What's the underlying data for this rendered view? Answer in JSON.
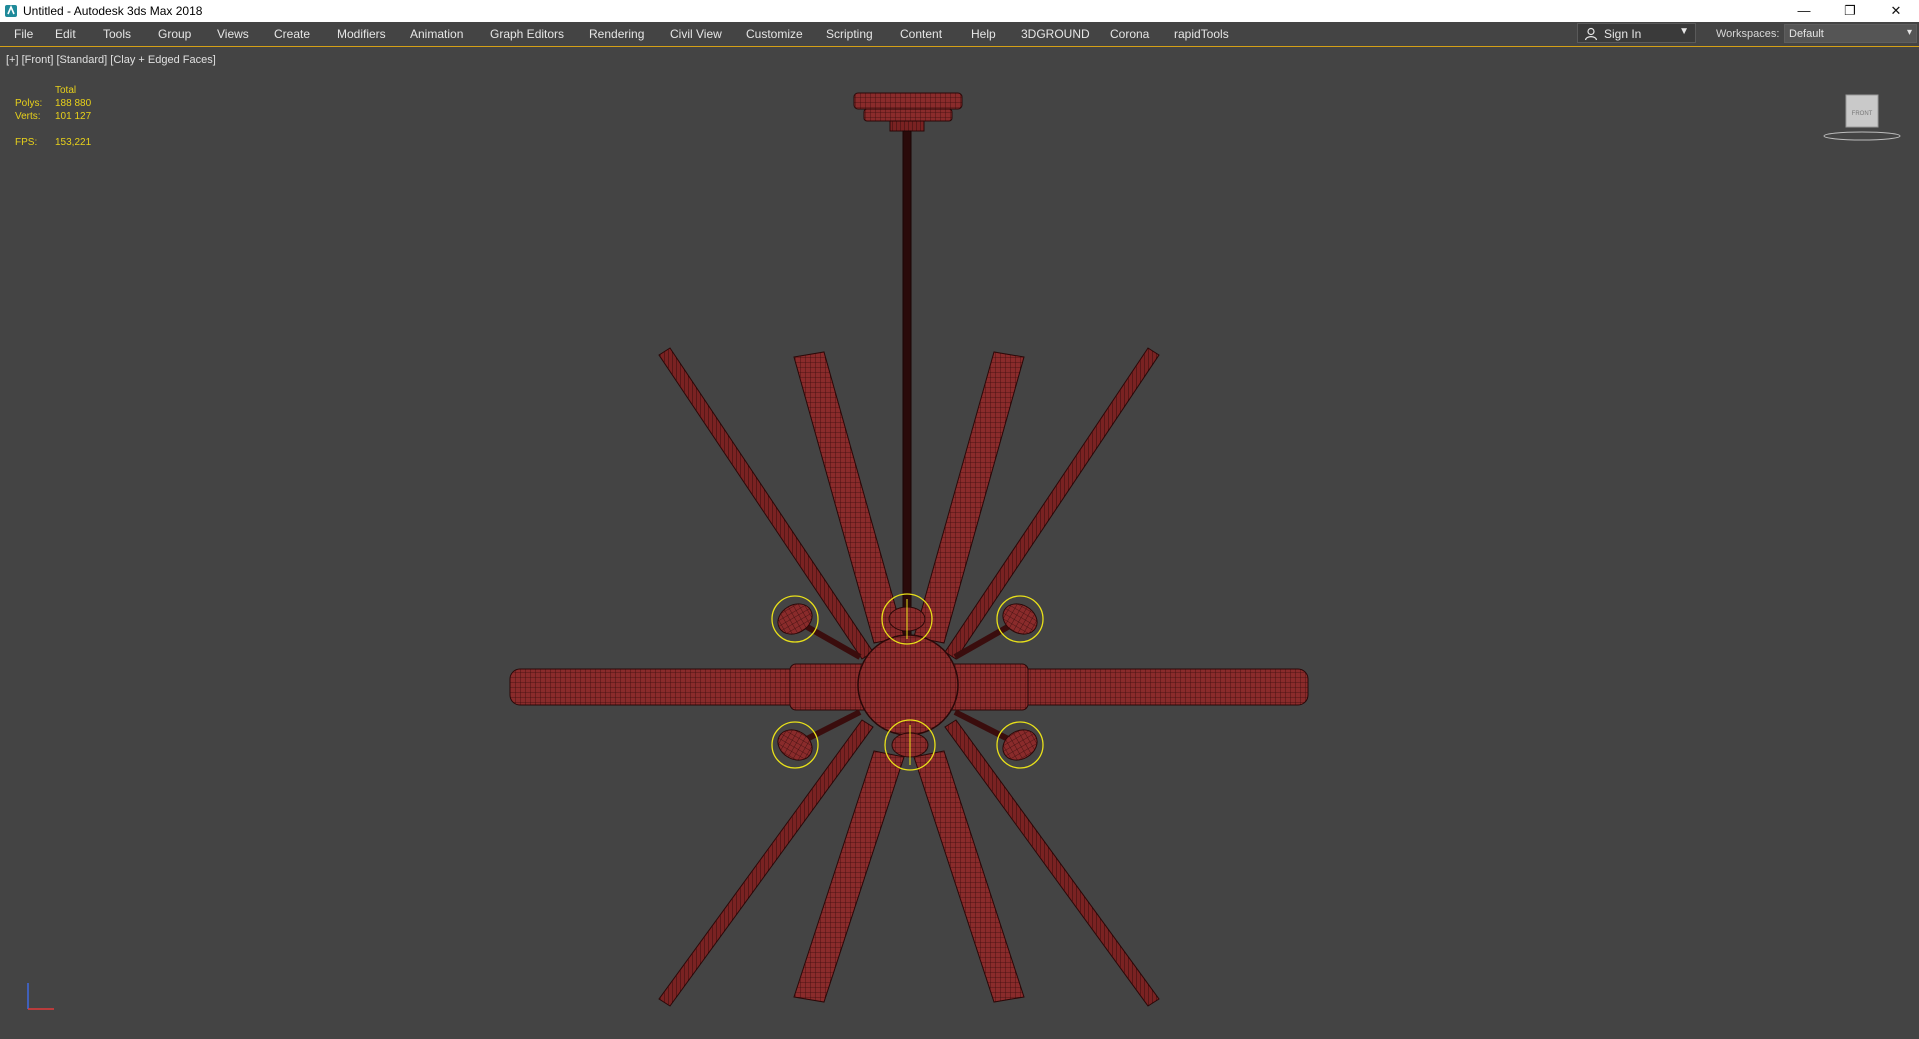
{
  "window": {
    "title": "Untitled - Autodesk 3ds Max 2018",
    "minimize": "—",
    "restore": "❐",
    "close": "✕"
  },
  "menu": [
    "File",
    "Edit",
    "Tools",
    "Group",
    "Views",
    "Create",
    "Modifiers",
    "Animation",
    "Graph Editors",
    "Rendering",
    "Civil View",
    "Customize",
    "Scripting",
    "Content",
    "Help",
    "3DGROUND",
    "Corona",
    "rapidTools"
  ],
  "account": {
    "sign_in_label": "Sign In",
    "icon": "user-icon"
  },
  "workspaces": {
    "label": "Workspaces:",
    "value": "Default"
  },
  "viewport": {
    "labels": [
      "[+]",
      "[Front]",
      "[Standard]",
      "[Clay + Edged Faces]"
    ],
    "stats": {
      "header": "Total",
      "polys_label": "Polys:",
      "polys_value": "188 880",
      "verts_label": "Verts:",
      "verts_value": "101 127",
      "fps_label": "FPS:",
      "fps_value": "153,221"
    },
    "viewcube_label": "FRONT"
  },
  "colors": {
    "viewport_bg": "#444444",
    "model_fill": "#8a2b2b",
    "wire": "#3a0d0d",
    "selection": "#e8e01a",
    "accent": "#d4a017"
  }
}
